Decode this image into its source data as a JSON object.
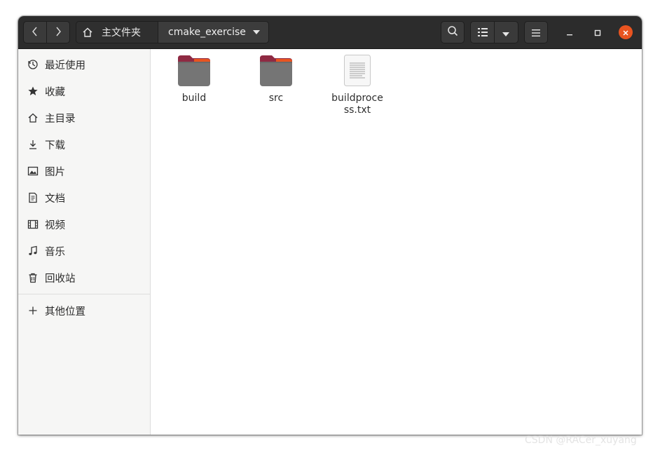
{
  "window": {
    "breadcrumb": {
      "home_label": "主文件夹",
      "current_label": "cmake_exercise"
    },
    "controls": {
      "back_icon": "chevron-left-icon",
      "forward_icon": "chevron-right-icon",
      "search_icon": "search-icon",
      "view_icon": "list-view-icon",
      "view_dropdown_icon": "caret-down-icon",
      "menu_icon": "hamburger-menu-icon",
      "minimize_icon": "minimize-icon",
      "maximize_icon": "maximize-icon",
      "close_icon": "close-icon",
      "close_color": "#e95420"
    }
  },
  "sidebar": {
    "items": [
      {
        "label": "最近使用",
        "icon": "recent-clock-icon"
      },
      {
        "label": "收藏",
        "icon": "star-icon"
      },
      {
        "label": "主目录",
        "icon": "home-icon"
      },
      {
        "label": "下载",
        "icon": "download-icon"
      },
      {
        "label": "图片",
        "icon": "pictures-icon"
      },
      {
        "label": "文档",
        "icon": "documents-icon"
      },
      {
        "label": "视频",
        "icon": "videos-icon"
      },
      {
        "label": "音乐",
        "icon": "music-icon"
      },
      {
        "label": "回收站",
        "icon": "trash-icon"
      }
    ],
    "other_locations": {
      "label": "其他位置",
      "icon": "plus-icon"
    }
  },
  "files": [
    {
      "name": "build",
      "type": "folder"
    },
    {
      "name": "src",
      "type": "folder"
    },
    {
      "name_line1": "buildproce",
      "name_line2": "ss.txt",
      "type": "text-file"
    }
  ],
  "colors": {
    "headerbar": "#2c2c2c",
    "folder_body": "#757575",
    "folder_tab": "#8f2a43",
    "folder_accent": "#e95420"
  },
  "watermark": "CSDN @RACer_xuyang"
}
